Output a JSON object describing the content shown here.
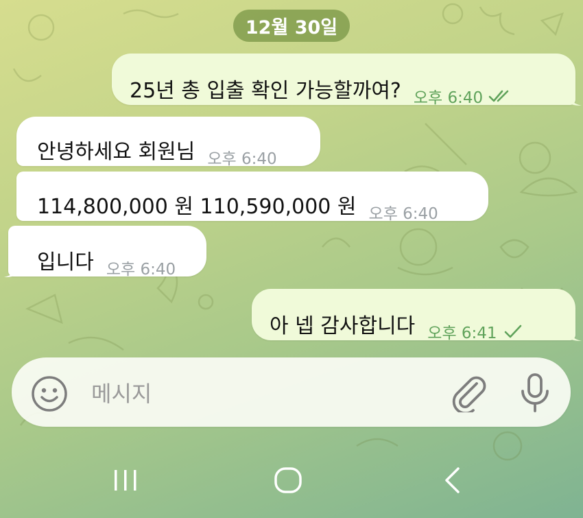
{
  "date_chip": "12월 30일",
  "messages": [
    {
      "direction": "outgoing",
      "text": "25년 총 입출 확인 가능할까여?",
      "time": "오후 6:40",
      "status": "read",
      "status_icon": "double-check-icon"
    },
    {
      "direction": "incoming",
      "text": "안녕하세요 회원님",
      "time": "오후 6:40"
    },
    {
      "direction": "incoming",
      "text": "114,800,000 원  110,590,000 원",
      "time": "오후 6:40"
    },
    {
      "direction": "incoming",
      "text": "입니다",
      "time": "오후 6:40"
    },
    {
      "direction": "outgoing",
      "text": "아 넵 감사합니다",
      "time": "오후 6:41",
      "status": "sent",
      "status_icon": "single-check-icon"
    }
  ],
  "input": {
    "placeholder": "메시지",
    "left_icon": "emoji-icon",
    "right_icons": [
      "attach-icon",
      "mic-icon"
    ]
  },
  "navbar": {
    "buttons": [
      "recent-apps-icon",
      "home-icon",
      "back-icon"
    ]
  },
  "colors": {
    "outgoing_bubble": "#f0fad9",
    "incoming_bubble": "#ffffff",
    "date_chip": "#7a9646",
    "check_color": "#5fa25a"
  }
}
